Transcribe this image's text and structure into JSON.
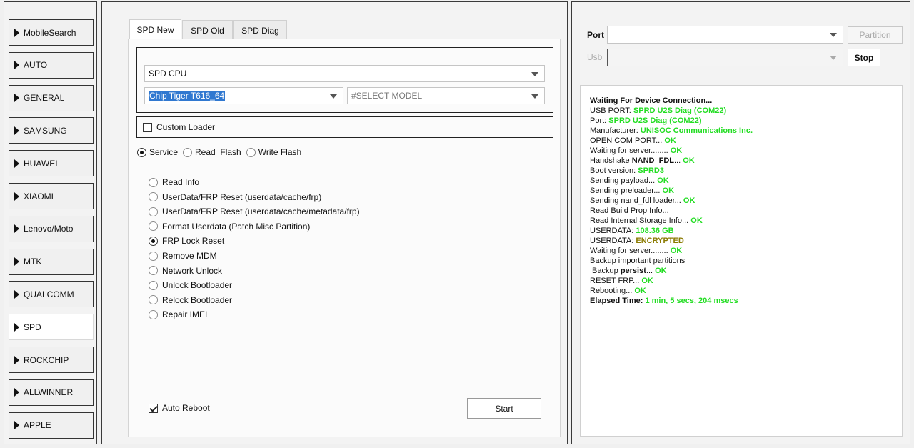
{
  "sidebar": {
    "items": [
      {
        "label": "MobileSearch"
      },
      {
        "label": "AUTO"
      },
      {
        "label": "GENERAL"
      },
      {
        "label": "SAMSUNG"
      },
      {
        "label": "HUAWEI"
      },
      {
        "label": "XIAOMI"
      },
      {
        "label": "Lenovo/Moto"
      },
      {
        "label": "MTK"
      },
      {
        "label": "QUALCOMM"
      },
      {
        "label": "SPD"
      },
      {
        "label": "ROCKCHIP"
      },
      {
        "label": "ALLWINNER"
      },
      {
        "label": "APPLE"
      }
    ],
    "active": "SPD"
  },
  "tabs": [
    {
      "label": "SPD New"
    },
    {
      "label": "SPD Old"
    },
    {
      "label": "SPD Diag"
    }
  ],
  "spd": {
    "cpu_select": "SPD CPU",
    "chip_select": "Chip Tiger T616_64",
    "model_select": "#SELECT MODEL",
    "custom_loader_label": "Custom Loader",
    "custom_loader_checked": false,
    "modes": [
      {
        "label": "Service",
        "checked": true
      },
      {
        "label": "Read  Flash",
        "checked": false
      },
      {
        "label": "Write Flash",
        "checked": false
      }
    ],
    "operations": [
      {
        "label": "Read Info",
        "checked": false
      },
      {
        "label": "UserData/FRP Reset (userdata/cache/frp)",
        "checked": false
      },
      {
        "label": "UserData/FRP Reset (userdata/cache/metadata/frp)",
        "checked": false
      },
      {
        "label": "Format Userdata (Patch Misc Partition)",
        "checked": false
      },
      {
        "label": "FRP Lock Reset",
        "checked": true
      },
      {
        "label": "Remove MDM",
        "checked": false
      },
      {
        "label": "Network Unlock",
        "checked": false
      },
      {
        "label": "Unlock Bootloader",
        "checked": false
      },
      {
        "label": "Relock Bootloader",
        "checked": false
      },
      {
        "label": "Repair IMEI",
        "checked": false
      }
    ],
    "auto_reboot_label": "Auto Reboot",
    "auto_reboot_checked": true,
    "start_label": "Start"
  },
  "right": {
    "port_label": "Port",
    "port_value": "",
    "partition_label": "Partition",
    "usb_label": "Usb",
    "usb_value": "",
    "stop_label": "Stop"
  },
  "log": [
    [
      {
        "t": "Waiting For Device Connection...",
        "c": "b"
      }
    ],
    [
      {
        "t": "USB PORT: "
      },
      {
        "t": "SPRD U2S Diag (COM22)",
        "c": "ok"
      }
    ],
    [
      {
        "t": "Port: "
      },
      {
        "t": "SPRD U2S Diag (COM22)",
        "c": "ok"
      }
    ],
    [
      {
        "t": "Manufacturer: "
      },
      {
        "t": "UNISOC Communications Inc.",
        "c": "ok"
      }
    ],
    [
      {
        "t": "OPEN COM PORT... "
      },
      {
        "t": "OK",
        "c": "ok"
      }
    ],
    [
      {
        "t": "Waiting for server........ "
      },
      {
        "t": "OK",
        "c": "ok"
      }
    ],
    [
      {
        "t": "Handshake "
      },
      {
        "t": "NAND_FDL",
        "c": "b"
      },
      {
        "t": "... "
      },
      {
        "t": "OK",
        "c": "ok"
      }
    ],
    [
      {
        "t": "Boot version: "
      },
      {
        "t": "SPRD3",
        "c": "ok"
      }
    ],
    [
      {
        "t": "Sending payload... "
      },
      {
        "t": "OK",
        "c": "ok"
      }
    ],
    [
      {
        "t": "Sending preloader... "
      },
      {
        "t": "OK",
        "c": "ok"
      }
    ],
    [
      {
        "t": "Sending nand_fdl loader... "
      },
      {
        "t": "OK",
        "c": "ok"
      }
    ],
    [
      {
        "t": "Read Build Prop Info..."
      }
    ],
    [
      {
        "t": "Read Internal Storage Info... "
      },
      {
        "t": "OK",
        "c": "ok"
      }
    ],
    [
      {
        "t": "USERDATA: "
      },
      {
        "t": "108.36 GB",
        "c": "ok"
      }
    ],
    [
      {
        "t": "USERDATA: "
      },
      {
        "t": "ENCRYPTED",
        "c": "warn"
      }
    ],
    [
      {
        "t": "Waiting for server........ "
      },
      {
        "t": "OK",
        "c": "ok"
      }
    ],
    [
      {
        "t": "Backup important partitions"
      }
    ],
    [
      {
        "t": " Backup "
      },
      {
        "t": "persist",
        "c": "b"
      },
      {
        "t": "... "
      },
      {
        "t": "OK",
        "c": "ok"
      }
    ],
    [
      {
        "t": "RESET FRP... "
      },
      {
        "t": "OK",
        "c": "ok"
      }
    ],
    [
      {
        "t": "Rebooting... "
      },
      {
        "t": "OK",
        "c": "ok"
      }
    ],
    [
      {
        "t": "Elapsed Time: ",
        "c": "b"
      },
      {
        "t": "1 min, 5 secs, 204 msecs",
        "c": "ok"
      }
    ]
  ],
  "colors": {
    "ok": "#22dd22",
    "warn": "#8a7a00",
    "selection": "#3078d0"
  }
}
